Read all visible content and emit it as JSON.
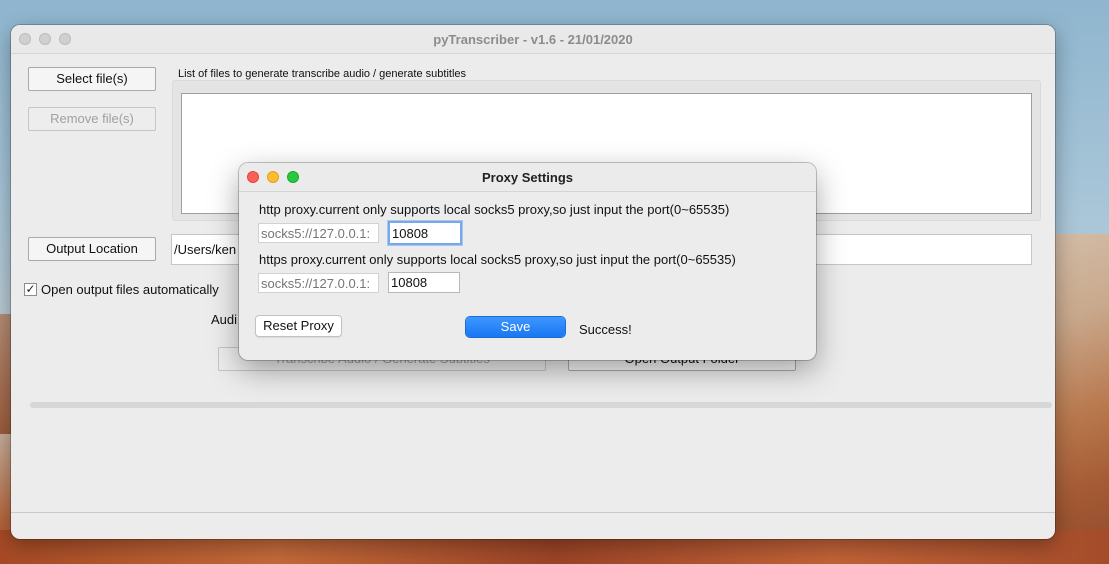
{
  "window": {
    "title": "pyTranscriber - v1.6 - 21/01/2020",
    "select_files_label": "Select file(s)",
    "remove_files_label": "Remove file(s)",
    "file_list_label": "List of files to generate transcribe audio / generate subtitles",
    "output_location_label": "Output Location",
    "output_path_value": "/Users/ken",
    "open_output_auto_label": "Open output files automatically",
    "open_output_auto_checked": true,
    "audio_label_partial": "Audi",
    "transcribe_button_label": "Transcribe Audio / Generate Subtitles",
    "open_output_folder_label": "Open Output Folder"
  },
  "dialog": {
    "title": "Proxy Settings",
    "http_label": "http proxy.current only supports local socks5 proxy,so just input the port(0~65535)",
    "http_prefix_placeholder": "socks5://127.0.0.1:",
    "http_port_value": "10808",
    "https_label": "https proxy.current only supports local socks5 proxy,so just input the port(0~65535)",
    "https_prefix_placeholder": "socks5://127.0.0.1:",
    "https_port_value": "10808",
    "reset_label": "Reset Proxy",
    "save_label": "Save",
    "status_text": "Success!"
  },
  "colors": {
    "close": "#fe5f57",
    "minimize": "#febc2e",
    "zoom": "#28c840",
    "accent": "#1a76f2"
  }
}
